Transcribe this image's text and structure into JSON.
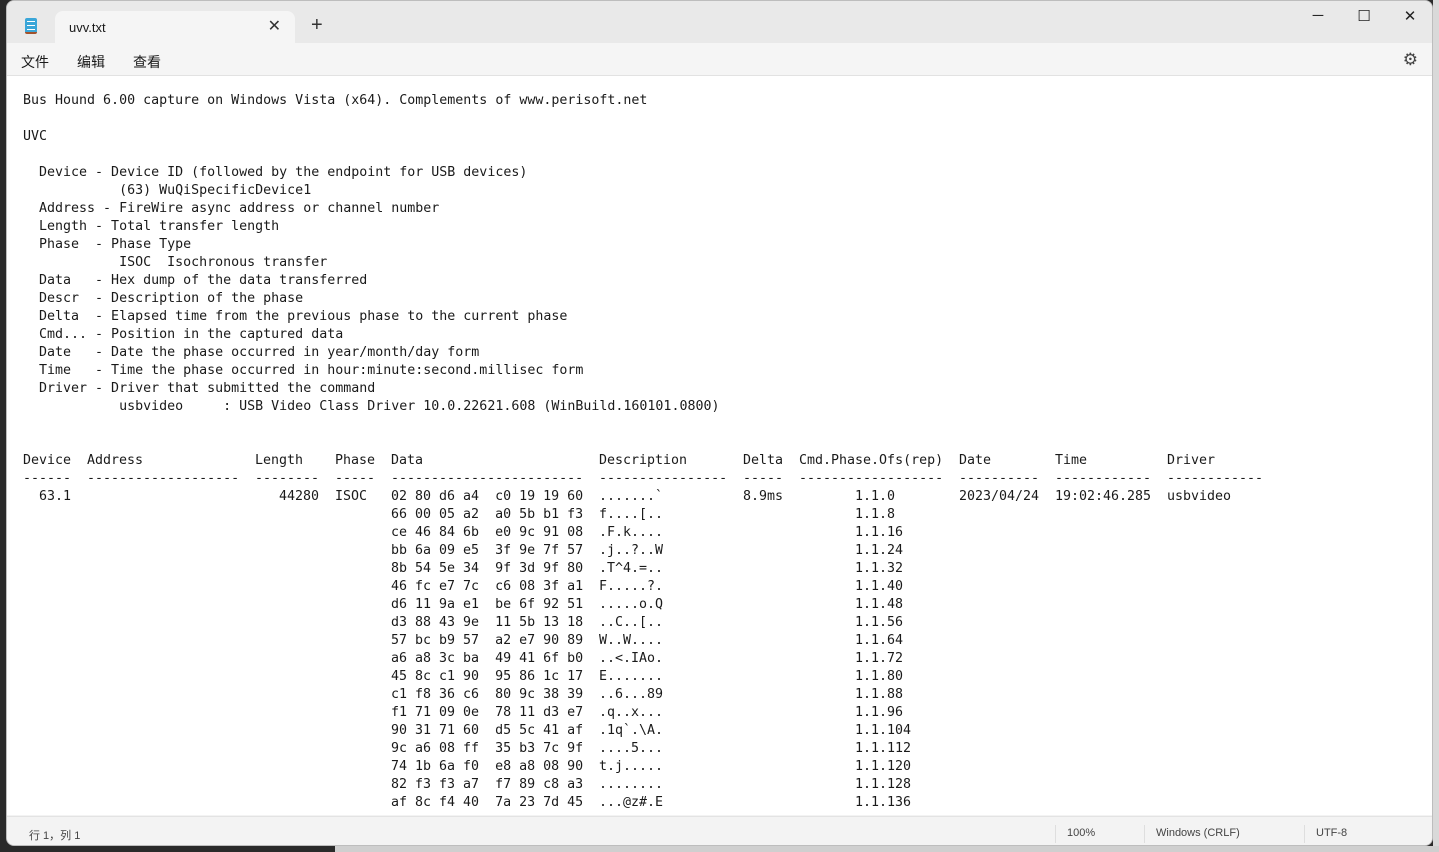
{
  "tab": {
    "title": "uvv.txt",
    "close_icon": "close-icon",
    "new_tab_icon": "plus-icon"
  },
  "window_controls": {
    "minimize": "─",
    "maximize": "☐",
    "close": "✕"
  },
  "menu": [
    "文件",
    "编辑",
    "查看"
  ],
  "settings_icon": "gear-icon",
  "preamble": [
    "Bus Hound 6.00 capture on Windows Vista (x64). Complements of www.perisoft.net",
    "",
    "UVC",
    "",
    "  Device - Device ID (followed by the endpoint for USB devices)",
    "            (63) WuQiSpecificDevice1",
    "  Address - FireWire async address or channel number",
    "  Length - Total transfer length",
    "  Phase  - Phase Type",
    "            ISOC  Isochronous transfer",
    "  Data   - Hex dump of the data transferred",
    "  Descr  - Description of the phase",
    "  Delta  - Elapsed time from the previous phase to the current phase",
    "  Cmd... - Position in the captured data",
    "  Date   - Date the phase occurred in year/month/day form",
    "  Time   - Time the phase occurred in hour:minute:second.millisec form",
    "  Driver - Driver that submitted the command",
    "            usbvideo     : USB Video Class Driver 10.0.22621.608 (WinBuild.160101.0800)",
    "",
    ""
  ],
  "table": {
    "headers": [
      "Device",
      "Address",
      "Length",
      "Phase",
      "Data",
      "Description",
      "Delta",
      "Cmd.Phase.Ofs(rep)",
      "Date",
      "Time",
      "Driver"
    ],
    "dashes": [
      "------",
      "-------------------",
      "--------",
      "-----",
      "------------------------",
      "----------------",
      "-----",
      "------------------",
      "----------",
      "------------",
      "------------"
    ],
    "rows": [
      {
        "device": "63.1",
        "length": "44280",
        "phase": "ISOC",
        "data": "02 80 d6 a4  c0 19 19 60",
        "desc": ".......`",
        "delta": "8.9ms",
        "cmd": "1.1.0",
        "date": "2023/04/24",
        "time": "19:02:46.285",
        "driver": "usbvideo"
      },
      {
        "data": "66 00 05 a2  a0 5b b1 f3",
        "desc": "f....[..",
        "cmd": "1.1.8"
      },
      {
        "data": "ce 46 84 6b  e0 9c 91 08",
        "desc": ".F.k....",
        "cmd": "1.1.16"
      },
      {
        "data": "bb 6a 09 e5  3f 9e 7f 57",
        "desc": ".j..?..W",
        "cmd": "1.1.24"
      },
      {
        "data": "8b 54 5e 34  9f 3d 9f 80",
        "desc": ".T^4.=..",
        "cmd": "1.1.32"
      },
      {
        "data": "46 fc e7 7c  c6 08 3f a1",
        "desc": "F.....?.",
        "cmd": "1.1.40"
      },
      {
        "data": "d6 11 9a e1  be 6f 92 51",
        "desc": ".....o.Q",
        "cmd": "1.1.48"
      },
      {
        "data": "d3 88 43 9e  11 5b 13 18",
        "desc": "..C..[..",
        "cmd": "1.1.56"
      },
      {
        "data": "57 bc b9 57  a2 e7 90 89",
        "desc": "W..W....",
        "cmd": "1.1.64"
      },
      {
        "data": "a6 a8 3c ba  49 41 6f b0",
        "desc": "..<.IAo.",
        "cmd": "1.1.72"
      },
      {
        "data": "45 8c c1 90  95 86 1c 17",
        "desc": "E.......",
        "cmd": "1.1.80"
      },
      {
        "data": "c1 f8 36 c6  80 9c 38 39",
        "desc": "..6...89",
        "cmd": "1.1.88"
      },
      {
        "data": "f1 71 09 0e  78 11 d3 e7",
        "desc": ".q..x...",
        "cmd": "1.1.96"
      },
      {
        "data": "90 31 71 60  d5 5c 41 af",
        "desc": ".1q`.\\A.",
        "cmd": "1.1.104"
      },
      {
        "data": "9c a6 08 ff  35 b3 7c 9f",
        "desc": "....5...",
        "cmd": "1.1.112"
      },
      {
        "data": "74 1b 6a f0  e8 a8 08 90",
        "desc": "t.j.....",
        "cmd": "1.1.120"
      },
      {
        "data": "82 f3 f3 a7  f7 89 c8 a3",
        "desc": "........",
        "cmd": "1.1.128"
      },
      {
        "data": "af 8c f4 40  7a 23 7d 45",
        "desc": "...@z#.E",
        "cmd": "1.1.136"
      }
    ]
  },
  "status": {
    "position": "行 1，列 1",
    "zoom": "100%",
    "line_ending": "Windows (CRLF)",
    "encoding": "UTF-8"
  }
}
